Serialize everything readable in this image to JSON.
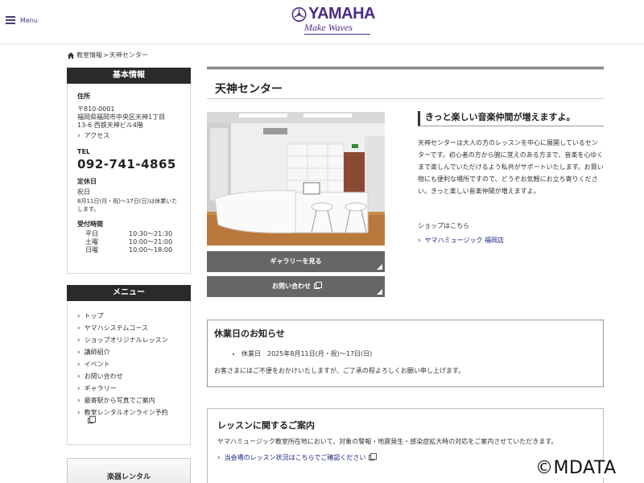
{
  "header": {
    "menu_label": "Menu",
    "logo_text": "YAMAHA",
    "logo_tagline": "Make Waves"
  },
  "breadcrumb": {
    "home_icon": "home-icon",
    "items": [
      "教室情報",
      "天神センター"
    ],
    "separator": ">"
  },
  "sidebar": {
    "basic_info": {
      "heading": "基本情報",
      "address_label": "住所",
      "postal": "〒810-0001",
      "address_line1": "福岡県福岡市中央区天神1丁目",
      "address_line2": "13-6 西鉄天神ビル4階",
      "access_link": "アクセス",
      "tel_label": "TEL",
      "tel": "092-741-4865",
      "closed_label": "定休日",
      "closed_day": "祝日",
      "closed_note": "8月11日(月・祝)～17日(日)は休業いたします。",
      "hours_label": "受付時間",
      "hours": [
        {
          "day": "平日",
          "time": "10:30～21:30"
        },
        {
          "day": "土曜",
          "time": "10:00～21:00"
        },
        {
          "day": "日曜",
          "time": "10:00～18:00"
        }
      ]
    },
    "menu": {
      "heading": "メニュー",
      "items": [
        {
          "label": "トップ",
          "external": false
        },
        {
          "label": "ヤマハシステムコース",
          "external": false
        },
        {
          "label": "ショップオリジナルレッスン",
          "external": false
        },
        {
          "label": "講師紹介",
          "external": false
        },
        {
          "label": "イベント",
          "external": false
        },
        {
          "label": "お問い合わせ",
          "external": false
        },
        {
          "label": "ギャラリー",
          "external": false
        },
        {
          "label": "最寄駅から写真でご案内",
          "external": false
        },
        {
          "label": "教室レンタルオンライン予約",
          "external": true
        }
      ]
    },
    "rental_button": "楽器レンタル"
  },
  "main": {
    "title": "天神センター",
    "gallery_button": "ギャラリーを見る",
    "contact_button": "お問い合わせ",
    "catch": "きっと楽しい音楽仲間が増えますよ。",
    "intro": "天神センターは大人の方のレッスンを中心に展開しているセンターです。初心者の方から腕に覚えのある方まで、音楽を心ゆくまで楽しんでいただけるよう私共がサポートいたします。お買い物にも便利な場所ですので、どうぞお気軽にお立ち寄りください。きっと楽しい音楽仲間が増えますよ。",
    "shop_label": "ショップはこちら",
    "shop_link": "ヤマハミュージック 福岡店",
    "notice": {
      "heading": "休業日のお知らせ",
      "item": "休業日　2025年8月11日(月・祝)～17日(日)",
      "note": "お客さまにはご不便をおかけいたしますが、ご了承の程よろしくお願い申し上げます。"
    },
    "lesson": {
      "heading": "レッスンに関するご案内",
      "text": "ヤマハミュージック教室所在地において、対象の警報・地震発生・感染症拡大時の対応をご案内させていただきます。",
      "link": "当会場のレッスン状況はこちらでご確認ください"
    }
  },
  "watermark": "©MDATA",
  "colors": {
    "brand": "#4b2b86",
    "heading_bar": "#2a2a2a",
    "button": "#666666",
    "link": "#1a237e"
  }
}
